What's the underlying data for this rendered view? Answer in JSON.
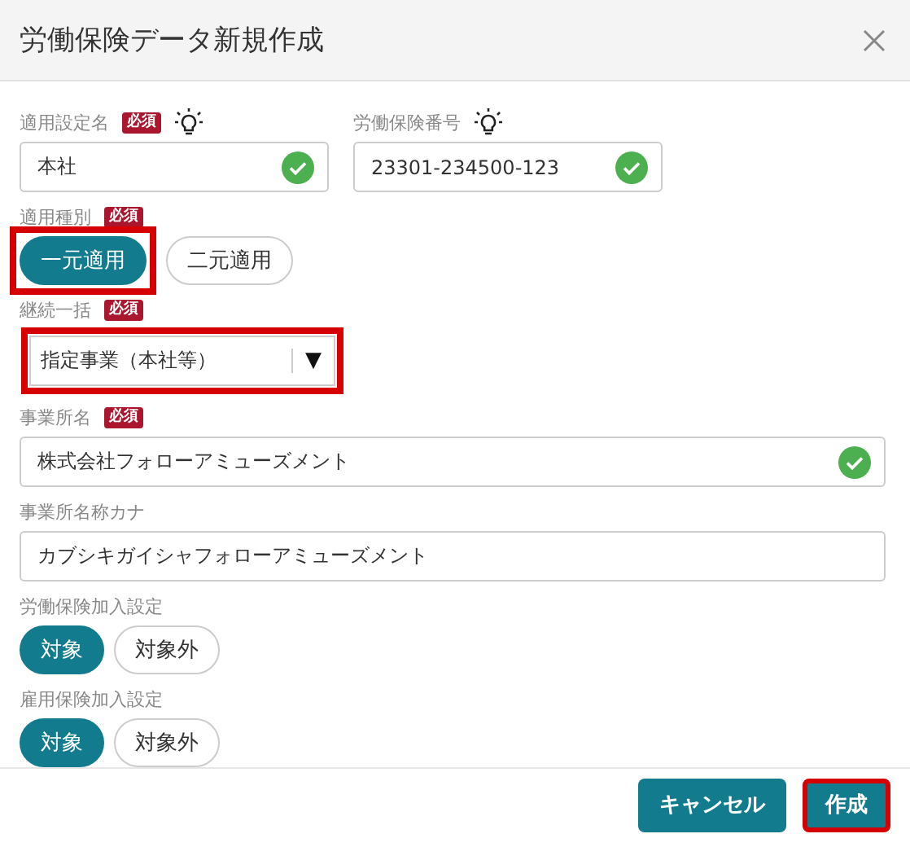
{
  "dialog": {
    "title": "労働保険データ新規作成"
  },
  "rows": [
    {
      "fields": [
        {
          "kind": "text",
          "label": "適用設定名",
          "badge": "必須",
          "hint": true,
          "value": "本社",
          "valid": true,
          "wide": false
        },
        {
          "kind": "text",
          "label": "労働保険番号",
          "hint": true,
          "value": "23301-234500-123",
          "valid": true,
          "wide": false
        }
      ]
    },
    {
      "fields": [
        {
          "kind": "toggle",
          "label": "適用種別",
          "badge": "必須",
          "options": [
            {
              "label": "一元適用",
              "selected": true,
              "highlighted": true
            },
            {
              "label": "二元適用",
              "selected": false,
              "highlighted": false
            }
          ]
        }
      ]
    },
    {
      "fields": [
        {
          "kind": "select",
          "label": "継続一括",
          "badge": "必須",
          "value": "指定事業（本社等）",
          "arrow": "▼",
          "highlighted": true
        }
      ]
    },
    {
      "fields": [
        {
          "kind": "text",
          "label": "事業所名",
          "badge": "必須",
          "hint": false,
          "value": "株式会社フォローアミューズメント",
          "valid": true,
          "wide": true
        }
      ]
    },
    {
      "fields": [
        {
          "kind": "text",
          "label": "事業所名称カナ",
          "hint": false,
          "value": "カブシキガイシャフォローアミューズメント",
          "valid": false,
          "wide": true
        }
      ]
    },
    {
      "fields": [
        {
          "kind": "toggle",
          "label": "労働保険加入設定",
          "options": [
            {
              "label": "対象",
              "selected": true,
              "highlighted": false
            },
            {
              "label": "対象外",
              "selected": false,
              "highlighted": false
            }
          ]
        }
      ]
    },
    {
      "fields": [
        {
          "kind": "toggle",
          "label": "雇用保険加入設定",
          "options": [
            {
              "label": "対象",
              "selected": true,
              "highlighted": false
            },
            {
              "label": "対象外",
              "selected": false,
              "highlighted": false
            }
          ]
        }
      ]
    }
  ],
  "buttons": [
    {
      "label": "キャンセル",
      "highlighted": false
    },
    {
      "label": "作成",
      "highlighted": true
    }
  ]
}
